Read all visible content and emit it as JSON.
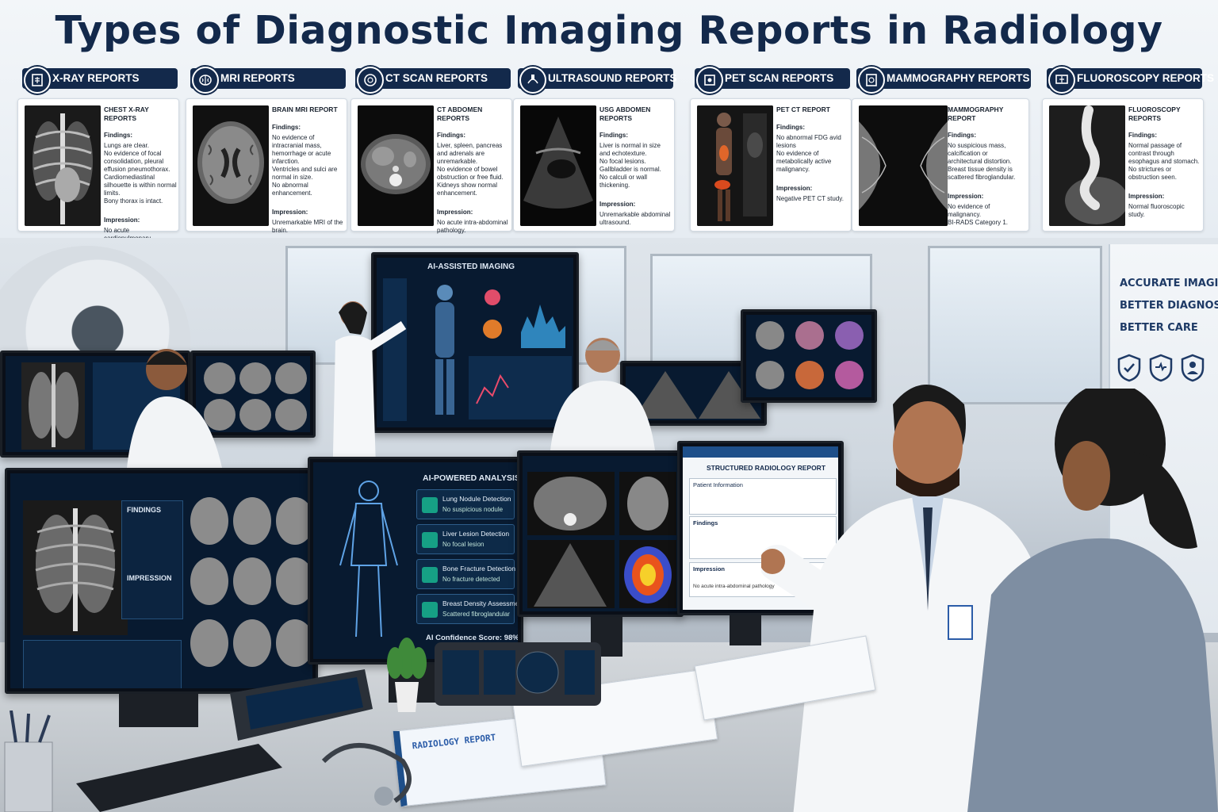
{
  "title": "Types of Diagnostic Imaging Reports in Radiology",
  "colors": {
    "navy": "#13294b",
    "accent": "#16a085",
    "screen": "#081a30"
  },
  "report_types": [
    {
      "tab": "X-RAY REPORTS",
      "icon": "xray-icon",
      "report_title": "CHEST X-RAY REPORTS",
      "findings_label": "Findings:",
      "findings": "Lungs are clear.\nNo evidence of focal consolidation, pleural effusion pneumothorax.\nCardiomediastinal silhouette is within normal limits.\nBony thorax is intact.",
      "impression_label": "Impression:",
      "impression": "No acute cardiopulmonary abnormality."
    },
    {
      "tab": "MRI REPORTS",
      "icon": "brain-icon",
      "report_title": "BRAIN MRI REPORT",
      "findings_label": "Findings:",
      "findings": "No evidence of intracranial mass, hemorrhage or acute infarction.\nVentricles and sulci are normal in size.\nNo abnormal enhancement.",
      "impression_label": "Impression:",
      "impression": "Unremarkable MRI of the brain."
    },
    {
      "tab": "CT SCAN REPORTS",
      "icon": "ct-icon",
      "report_title": "CT ABDOMEN REPORTS",
      "findings_label": "Findings:",
      "findings": "Liver, spleen, pancreas and adrenals are unremarkable.\nNo evidence of bowel obstruction or free fluid.\nKidneys show normal enhancement.",
      "impression_label": "Impression:",
      "impression": "No acute intra-abdominal pathology."
    },
    {
      "tab": "ULTRASOUND REPORTS",
      "icon": "ultrasound-icon",
      "report_title": "USG ABDOMEN REPORTS",
      "findings_label": "Findings:",
      "findings": "Liver is normal in size and echotexture.\nNo focal lesions.\nGallbladder is normal.\nNo calculi or wall thickening.",
      "impression_label": "Impression:",
      "impression": "Unremarkable abdominal ultrasound."
    },
    {
      "tab": "PET SCAN REPORTS",
      "icon": "pet-icon",
      "report_title": "PET CT REPORT",
      "findings_label": "Findings:",
      "findings": "No abnormal FDG avid lesions\nNo evidence of metabolically active malignancy.",
      "impression_label": "Impression:",
      "impression": "Negative PET CT study."
    },
    {
      "tab": "MAMMOGRAPHY REPORTS",
      "icon": "mammography-icon",
      "report_title": "MAMMOGRAPHY REPORT",
      "findings_label": "Findings:",
      "findings": "No suspicious mass, calcification or architectural distortion.\nBreast tissue density is scattered fibroglandular.",
      "impression_label": "Impression:",
      "impression": "No evidence of malignancy.\nBI-RADS Category 1."
    },
    {
      "tab": "FLUOROSCOPY REPORTS",
      "icon": "fluoroscopy-icon",
      "report_title": "FLUOROSCOPY REPORTS",
      "findings_label": "Findings:",
      "findings": "Normal passage of contrast through esophagus and stomach.\nNo strictures or obstruction seen.",
      "impression_label": "Impression:",
      "impression": "Normal fluoroscopic study."
    }
  ],
  "poster": {
    "line1": "ACCURATE IMAGING",
    "line2": "BETTER DIAGNOSIS",
    "line3": "BETTER CARE"
  },
  "wall_screen": {
    "title": "AI-ASSISTED IMAGING"
  },
  "monitor_xray": {
    "findings_label": "FINDINGS",
    "impression_label": "IMPRESSION"
  },
  "ai_panel": {
    "title": "AI-POWERED ANALYSIS",
    "rows": [
      {
        "name": "Lung Nodule Detection",
        "result": "No suspicious nodule"
      },
      {
        "name": "Liver Lesion Detection",
        "result": "No focal lesion"
      },
      {
        "name": "Bone Fracture Detection",
        "result": "No fracture detected"
      },
      {
        "name": "Breast Density Assessment",
        "result": "Scattered fibroglandular"
      }
    ],
    "confidence": "AI Confidence Score: 98%"
  },
  "report_monitor": {
    "title": "STRUCTURED RADIOLOGY REPORT",
    "patient_info": "Patient Information",
    "findings": "Findings",
    "impression": "Impression",
    "impression_text": "No acute intra-abdominal pathology"
  },
  "desk_report": {
    "title": "RADIOLOGY REPORT"
  }
}
